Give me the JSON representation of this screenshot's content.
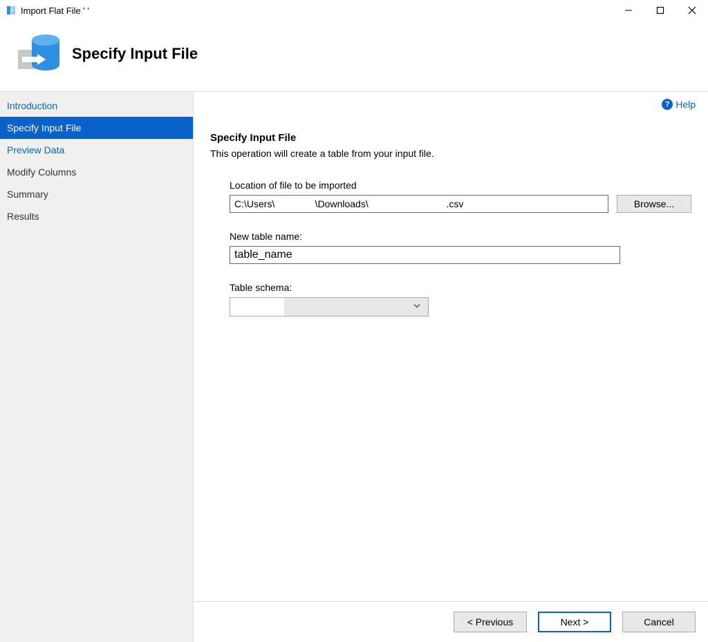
{
  "window": {
    "title": "Import Flat File '                       '"
  },
  "header": {
    "heading": "Specify Input File"
  },
  "help": {
    "label": "Help"
  },
  "sidebar": {
    "items": [
      {
        "label": "Introduction",
        "link": true,
        "active": false
      },
      {
        "label": "Specify Input File",
        "link": false,
        "active": true
      },
      {
        "label": "Preview Data",
        "link": true,
        "active": false
      },
      {
        "label": "Modify Columns",
        "link": false,
        "active": false
      },
      {
        "label": "Summary",
        "link": false,
        "active": false
      },
      {
        "label": "Results",
        "link": false,
        "active": false
      }
    ]
  },
  "form": {
    "heading": "Specify Input File",
    "description": "This operation will create a table from your input file.",
    "location_label": "Location of file to be imported",
    "location_value": "C:\\Users\\               \\Downloads\\                             .csv",
    "browse_label": "Browse...",
    "tablename_label": "New table name:",
    "tablename_value": "table_name",
    "schema_label": "Table schema:",
    "schema_value": ""
  },
  "footer": {
    "previous": "< Previous",
    "next": "Next >",
    "cancel": "Cancel"
  }
}
